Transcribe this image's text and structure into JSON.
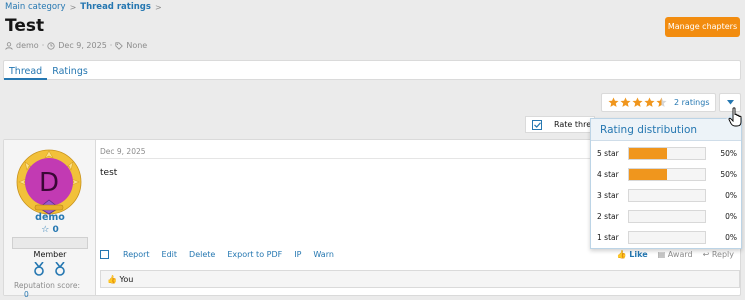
{
  "breadcrumb": {
    "items": [
      "Main category",
      "Thread ratings"
    ],
    "separator": ">"
  },
  "page": {
    "title": "Test"
  },
  "meta": {
    "author": "demo",
    "date": "Dec 9, 2025",
    "tags": "None"
  },
  "header": {
    "manage_label": "Manage chapters"
  },
  "tabs": [
    {
      "label": "Thread",
      "active": true
    },
    {
      "label": "Ratings",
      "active": false
    }
  ],
  "rating": {
    "value": 4.5,
    "max": 5,
    "link": "2 ratings"
  },
  "rate_bar": {
    "label": "Rate thread"
  },
  "distribution": {
    "title": "Rating distribution",
    "rows": [
      {
        "label": "5 star",
        "percent_value": 50,
        "percent": "50%"
      },
      {
        "label": "4 star",
        "percent_value": 50,
        "percent": "50%"
      },
      {
        "label": "3 star",
        "percent_value": 0,
        "percent": "0%"
      },
      {
        "label": "2 star",
        "percent_value": 0,
        "percent": "0%"
      },
      {
        "label": "1 star",
        "percent_value": 0,
        "percent": "0%"
      }
    ]
  },
  "post": {
    "date": "Dec 9, 2025",
    "body": "test",
    "actions": [
      "Report",
      "Edit",
      "Delete",
      "Export to PDF",
      "IP",
      "Warn"
    ],
    "right_actions": {
      "like": "Like",
      "award": "Award",
      "reply": "Reply"
    },
    "reactions": "You"
  },
  "user": {
    "name": "demo",
    "initial": "D",
    "score": "0",
    "title": "Member",
    "reputation_label": "Reputation score:",
    "reputation_value": "0"
  },
  "colors": {
    "accent": "#2577b1",
    "orange": "#f28c0f",
    "bar_fill": "#f0961d",
    "avatar": "#c23ab3"
  }
}
